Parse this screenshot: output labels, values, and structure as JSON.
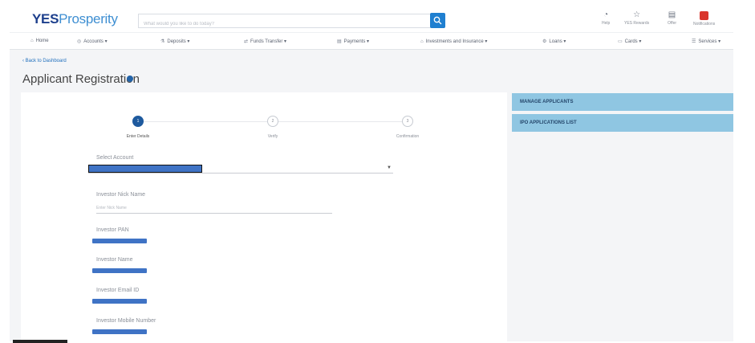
{
  "app": {
    "logo_bold": "YES",
    "logo_light": "Prosperity",
    "search_placeholder": "What would you like to do today?"
  },
  "toolbar": [
    {
      "label": "Help",
      "icon": "help-icon",
      "glyph": "◔"
    },
    {
      "label": "YES Rewards",
      "icon": "star-icon",
      "glyph": "☆"
    },
    {
      "label": "Offer",
      "icon": "offer-icon",
      "glyph": "▤"
    },
    {
      "label": "Notifications",
      "icon": "bell-icon",
      "glyph": ""
    }
  ],
  "nav": [
    {
      "label": "Home",
      "glyph": "⌂"
    },
    {
      "label": "Accounts ▾",
      "glyph": "◎"
    },
    {
      "label": "Deposits ▾",
      "glyph": "⚗"
    },
    {
      "label": "Funds Transfer ▾",
      "glyph": "⇄"
    },
    {
      "label": "Payments ▾",
      "glyph": "▤"
    },
    {
      "label": "Investments and Insurance ▾",
      "glyph": "⌂"
    },
    {
      "label": "Loans ▾",
      "glyph": "⚙"
    },
    {
      "label": "Cards ▾",
      "glyph": "▭"
    },
    {
      "label": "Services ▾",
      "glyph": "☰"
    }
  ],
  "page": {
    "back_link": "‹ Back to Dashboard",
    "title": "Applicant Registration"
  },
  "steps": [
    {
      "number": "1",
      "label": "Enter Details",
      "active": true
    },
    {
      "number": "2",
      "label": "Verify",
      "active": false
    },
    {
      "number": "3",
      "label": "Confirmation",
      "active": false
    }
  ],
  "form": {
    "select_account_label": "Select Account",
    "nick_name_label": "Investor Nick Name",
    "nick_name_placeholder": "Enter Nick Name",
    "pan_label": "Investor PAN",
    "name_label": "Investor Name",
    "email_label": "Investor Email ID",
    "mobile_label": "Investor Mobile Number"
  },
  "side_panel": {
    "items": [
      "MANAGE APPLICANTS",
      "IPO APPLICATIONS LIST"
    ]
  },
  "colors": {
    "brand_dark": "#1d3f8c",
    "brand_light": "#3f8fd2",
    "side_panel": "#8fc6e2",
    "redaction": "#3f73c5",
    "notification": "#d9352c"
  }
}
